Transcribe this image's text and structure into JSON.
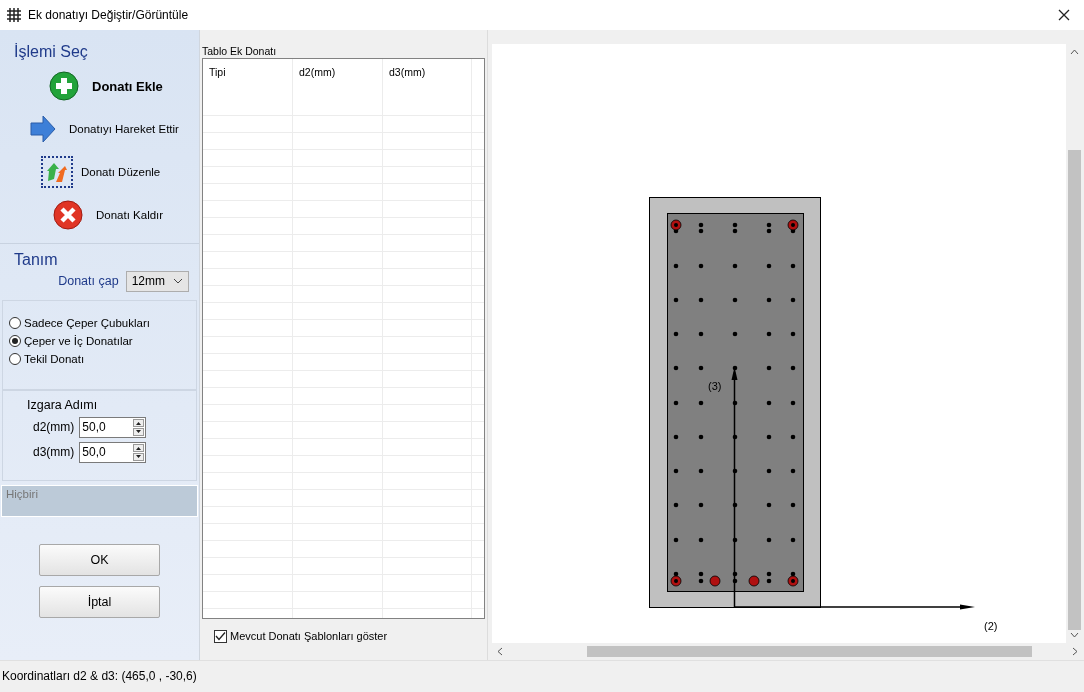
{
  "window": {
    "title": "Ek donatıyı Değiştir/Görüntüle"
  },
  "sidebar": {
    "heading": "İşlemi Seç",
    "actions": [
      {
        "kind": "add",
        "label": "Donatı Ekle",
        "focused": false
      },
      {
        "kind": "move",
        "label": "Donatıyı Hareket Ettir",
        "focused": false
      },
      {
        "kind": "edit",
        "label": "Donatı Düzenle",
        "focused": true
      },
      {
        "kind": "remove",
        "label": "Donatı Kaldır",
        "focused": false
      }
    ],
    "definition": {
      "heading": "Tanım",
      "diameter_label": "Donatı çap",
      "diameter_value": "12mm"
    },
    "options": [
      {
        "label": "Sadece Çeper Çubukları",
        "selected": false
      },
      {
        "label": "Çeper ve İç Donatılar",
        "selected": true
      },
      {
        "label": "Tekil Donatı",
        "selected": false
      }
    ],
    "grid_step": {
      "heading": "Izgara Adımı",
      "fields": [
        {
          "label": "d2(mm)",
          "value": "50,0"
        },
        {
          "label": "d3(mm)",
          "value": "50,0"
        }
      ]
    },
    "info": "Hiçbiri",
    "buttons": [
      "OK",
      "İptal"
    ]
  },
  "table": {
    "caption": "Tablo Ek Donatı",
    "columns": [
      "Tipi",
      "d2(mm)",
      "d3(mm)"
    ]
  },
  "show_templates": {
    "label": "Mevcut Donatı Şablonları göster",
    "checked": true
  },
  "canvas": {
    "axis_3_label": "(3)",
    "axis_2_label": "(2)"
  },
  "status_bar": "Koordinatları d2 & d3: (465,0 , -30,6)"
}
